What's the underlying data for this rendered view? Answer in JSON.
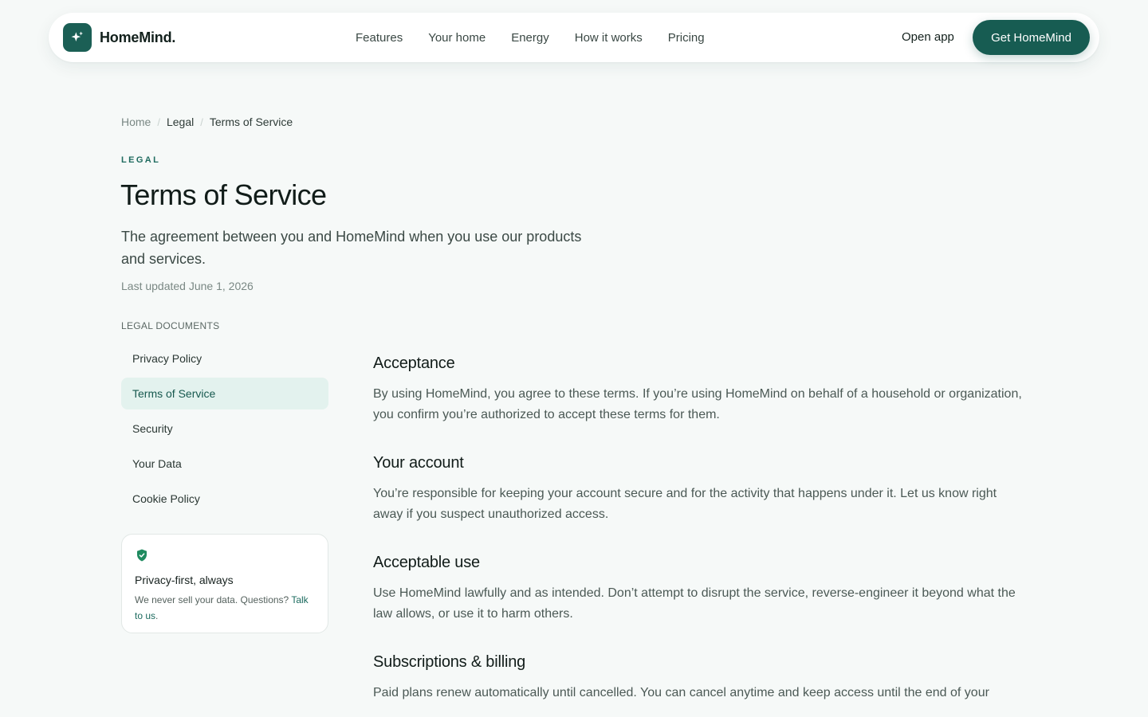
{
  "nav": {
    "brand": "HomeMind.",
    "links": [
      "Features",
      "Your home",
      "Energy",
      "How it works",
      "Pricing"
    ],
    "open_app": "Open app",
    "cta": "Get HomeMind"
  },
  "breadcrumb": {
    "home": "Home",
    "legal": "Legal",
    "current": "Terms of Service",
    "separator": "/"
  },
  "header": {
    "eyebrow": "LEGAL",
    "title": "Terms of Service",
    "subtitle": "The agreement between you and HomeMind when you use our products and services.",
    "updated": "Last updated June 1, 2026"
  },
  "sidebar": {
    "heading": "LEGAL DOCUMENTS",
    "items": [
      "Privacy Policy",
      "Terms of Service",
      "Security",
      "Your Data",
      "Cookie Policy"
    ],
    "active": "Terms of Service",
    "card": {
      "title": "Privacy-first, always",
      "text": "We never sell your data. Questions? ",
      "link": "Talk to us",
      "after_link": "."
    }
  },
  "sections": [
    {
      "title": "Acceptance",
      "body": "By using HomeMind, you agree to these terms. If you’re using HomeMind on behalf of a household or organization, you confirm you’re authorized to accept these terms for them."
    },
    {
      "title": "Your account",
      "body": "You’re responsible for keeping your account secure and for the activity that happens under it. Let us know right away if you suspect unauthorized access."
    },
    {
      "title": "Acceptable use",
      "body": "Use HomeMind lawfully and as intended. Don’t attempt to disrupt the service, reverse-engineer it beyond what the law allows, or use it to harm others."
    },
    {
      "title": "Subscriptions & billing",
      "body": "Paid plans renew automatically until cancelled. You can cancel anytime and keep access until the end of your"
    }
  ],
  "colors": {
    "accent": "#175c52",
    "active_bg": "#e3f2ee",
    "page_bg": "#f6f9f8",
    "shield": "#1f8a5f"
  },
  "icons": {
    "brand": "sparkle-icon",
    "card": "shield-check-icon"
  }
}
